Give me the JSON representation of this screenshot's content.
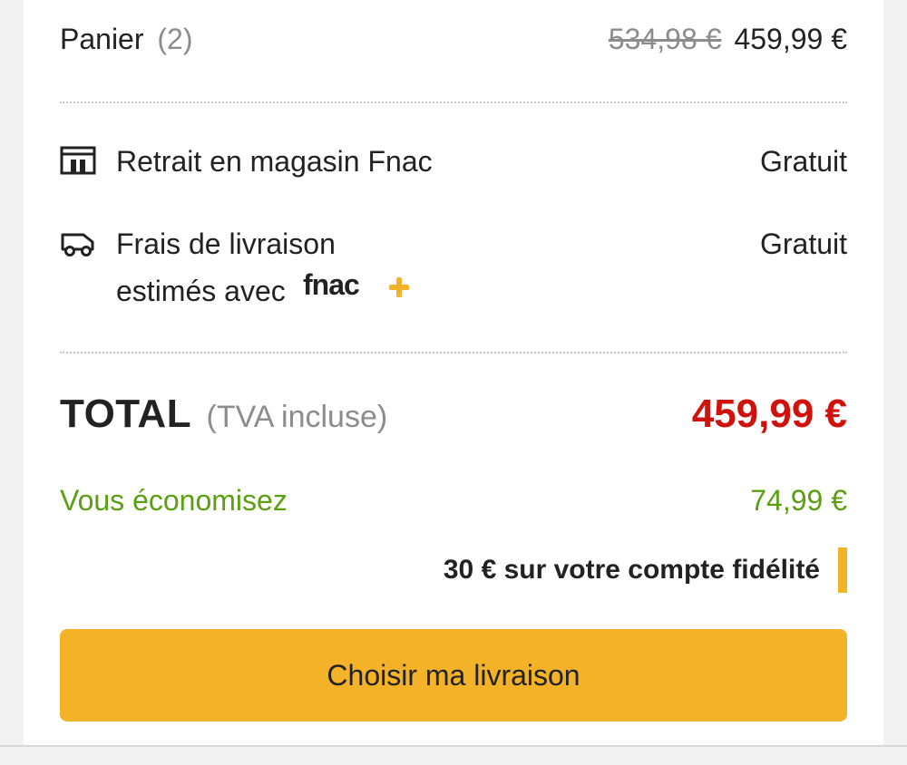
{
  "cart": {
    "label": "Panier",
    "count": "(2)",
    "old_price": "534,98 €",
    "price": "459,99 €"
  },
  "pickup": {
    "icon": "store-icon",
    "label": "Retrait en magasin Fnac",
    "value": "Gratuit"
  },
  "delivery": {
    "icon": "truck-icon",
    "label_line1": "Frais de livraison",
    "label_line2": "estimés avec",
    "brand": "fnac+",
    "value": "Gratuit"
  },
  "total": {
    "label": "TOTAL",
    "tax_note": "(TVA incluse)",
    "value": "459,99 €"
  },
  "savings": {
    "label": "Vous économisez",
    "value": "74,99 €"
  },
  "loyalty": {
    "text": "30 € sur votre compte fidélité"
  },
  "cta": {
    "label": "Choisir ma livraison"
  },
  "colors": {
    "accent": "#f4b229",
    "total_red": "#d0120c",
    "savings_green": "#5aa012"
  }
}
